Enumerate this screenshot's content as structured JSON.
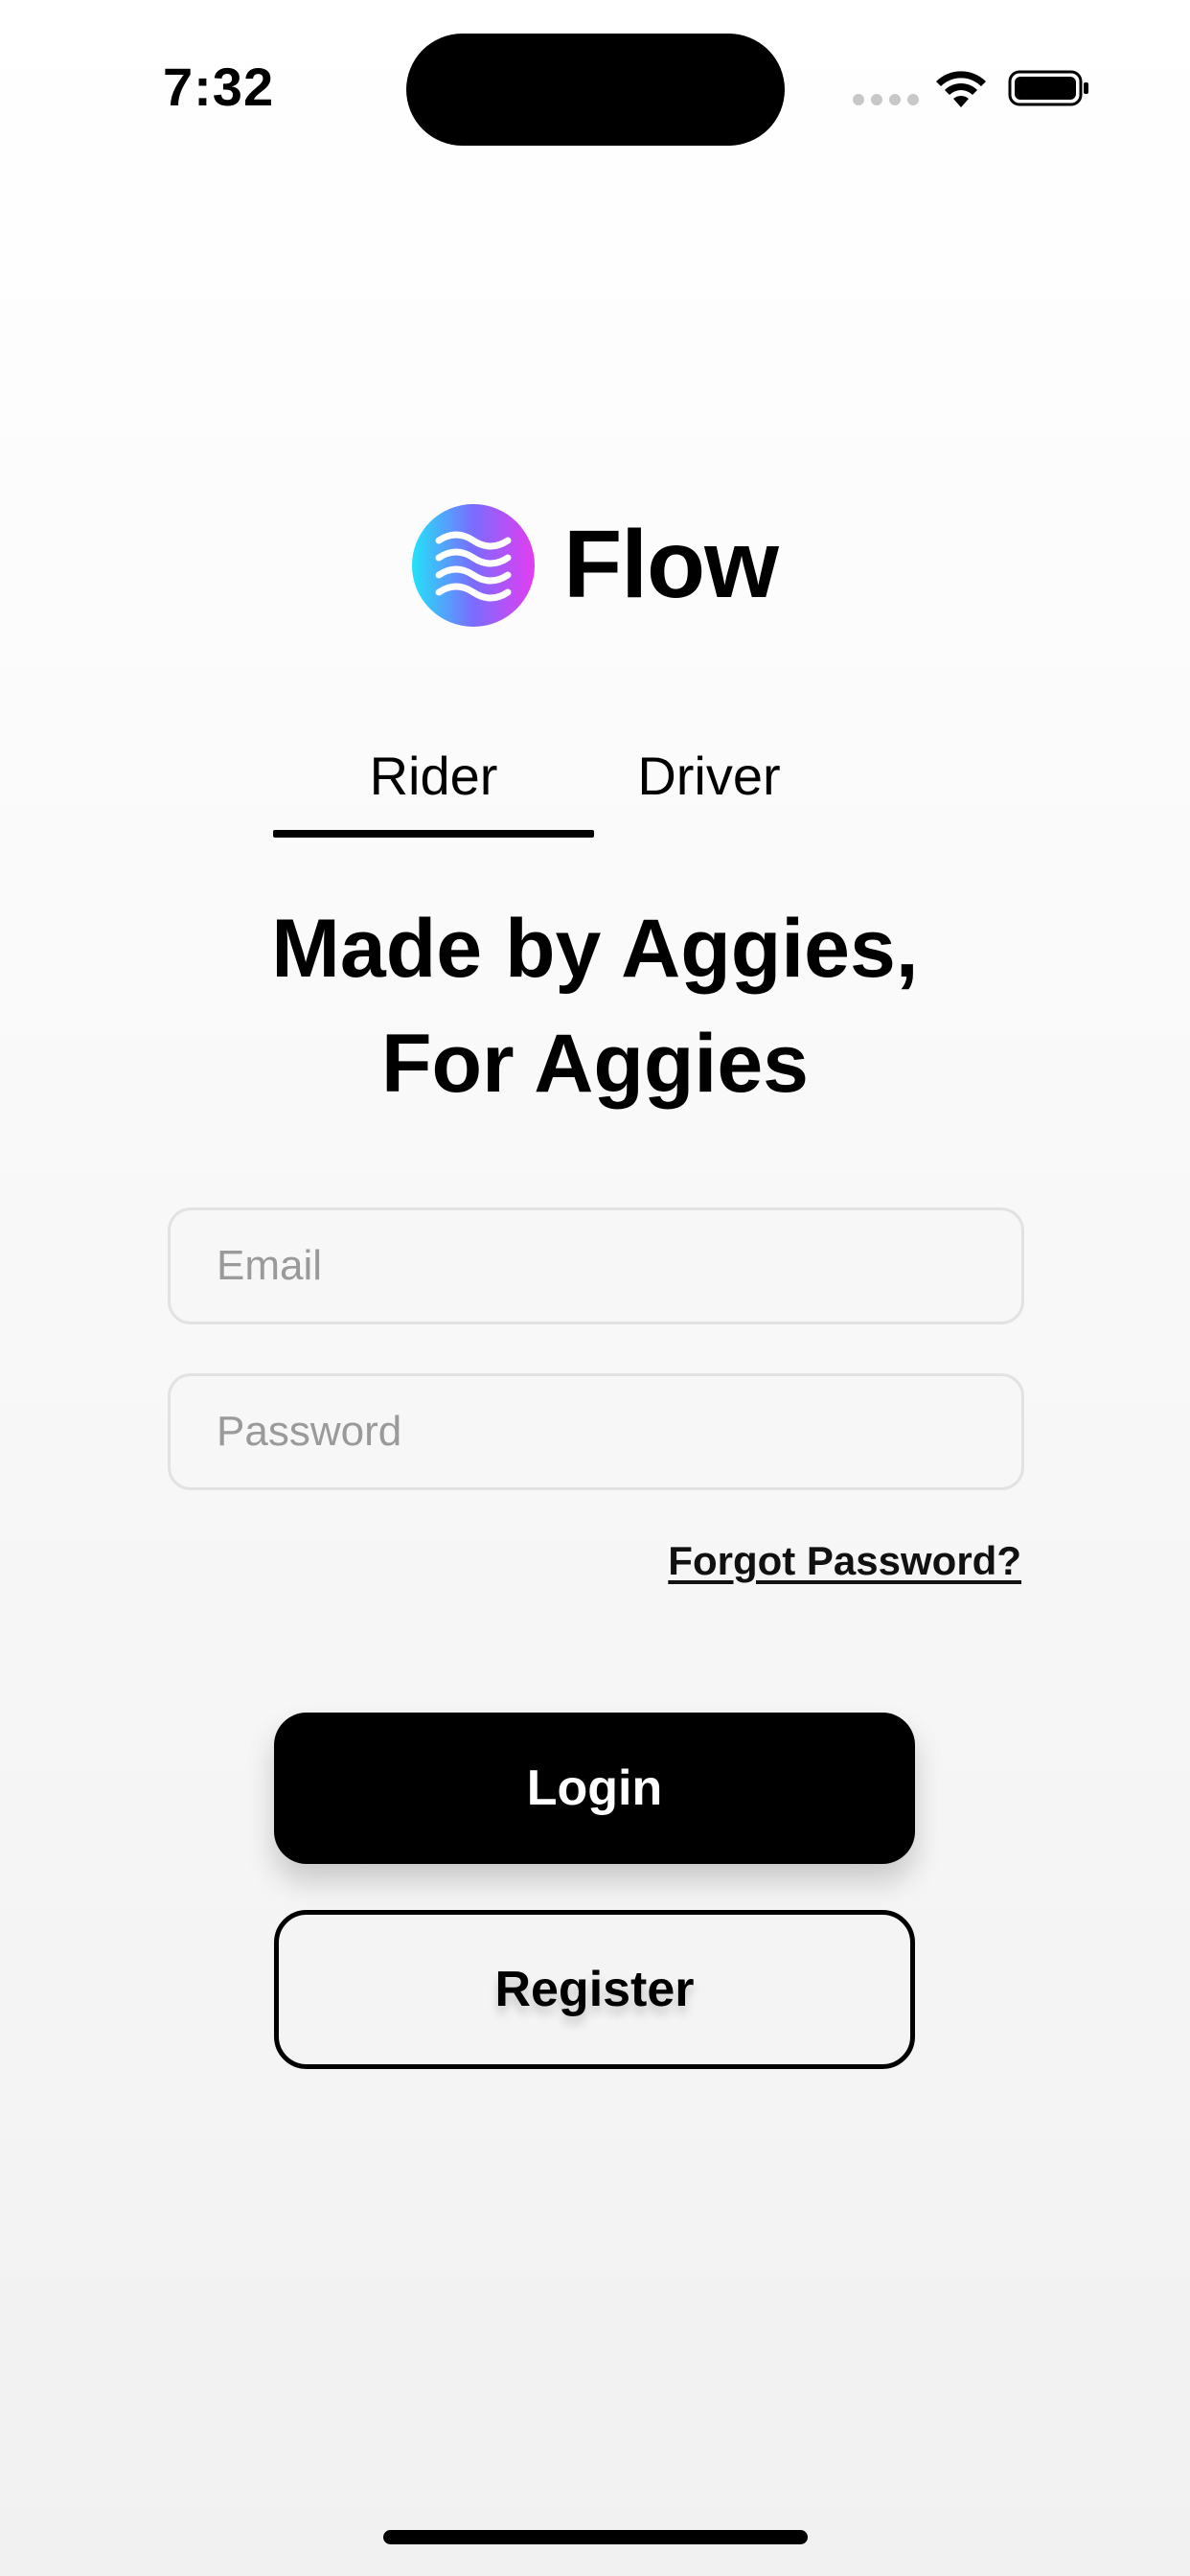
{
  "status_bar": {
    "time": "7:32",
    "icons": [
      "cellular-signal-icon",
      "wifi-icon",
      "battery-icon"
    ]
  },
  "app": {
    "title": "Flow",
    "logo_icon": "waves-logo-icon",
    "brand_gradient": [
      "#22e3f7",
      "#7b6cff",
      "#e43cf0"
    ]
  },
  "tabs": [
    {
      "label": "Rider",
      "selected": true
    },
    {
      "label": "Driver",
      "selected": false
    }
  ],
  "headline": {
    "line1": "Made by Aggies,",
    "line2": "For Aggies"
  },
  "form": {
    "email": {
      "value": "",
      "placeholder": "Email"
    },
    "password": {
      "value": "",
      "placeholder": "Password"
    },
    "forgot_password_label": "Forgot Password?"
  },
  "buttons": {
    "login_label": "Login",
    "register_label": "Register"
  },
  "colors": {
    "primary": "#000000",
    "field_border": "#e2e2e2",
    "placeholder": "#9a9a9a"
  }
}
